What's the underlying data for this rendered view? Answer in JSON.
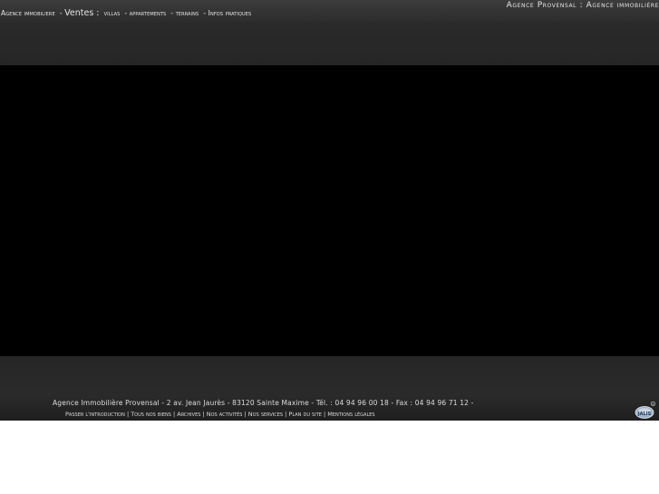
{
  "header": {
    "agency_prefix": "Agence immobiliere",
    "ventes_label": "Ventes :",
    "nav": [
      "villas",
      "appartements",
      "terrains",
      "Infos pratiques"
    ],
    "site_title": "Agence Provensal : Agence immobilière"
  },
  "footer": {
    "address": "Agence Immobilière Provensal - 2 av. Jean Jaurès - 83120 Sainte Maxime - Tél. : 04 94 96 00 18 - Fax : 04 94 96 71 12 -",
    "links": [
      "Passer l'introduction",
      "Tous nos biens",
      "Archives",
      "Nos activités",
      "Nos services",
      "Plan du site",
      "Mentions légales"
    ],
    "badge": "JALIS",
    "badge_icon": "jalis-logo-icon"
  },
  "colors": {
    "bar": "#2c2c2c",
    "stage": "#000000",
    "text": "#e6e6e6"
  }
}
